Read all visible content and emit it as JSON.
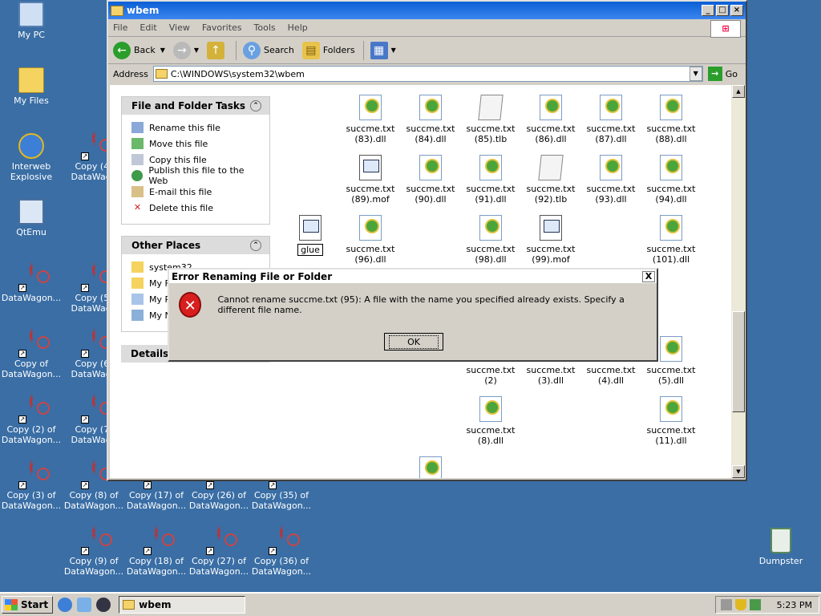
{
  "desktop": {
    "icons": [
      {
        "line1": "My PC",
        "line2": ""
      },
      {
        "line1": "My Files",
        "line2": ""
      },
      {
        "line1": "Interweb",
        "line2": "Explosive"
      },
      {
        "line1": "Copy (4)",
        "line2": "DataWago"
      },
      {
        "line1": "QtEmu",
        "line2": ""
      },
      {
        "line1": "DataWagon...",
        "line2": ""
      },
      {
        "line1": "Copy (5)",
        "line2": "DataWago"
      },
      {
        "line1": "Copy of",
        "line2": "DataWagon..."
      },
      {
        "line1": "Copy (6)",
        "line2": "DataWago"
      },
      {
        "line1": "Copy (2) of",
        "line2": "DataWagon..."
      },
      {
        "line1": "Copy (7)",
        "line2": "DataWago"
      },
      {
        "line1": "Copy (3) of",
        "line2": "DataWagon..."
      },
      {
        "line1": "Copy (8) of",
        "line2": "DataWagon..."
      },
      {
        "line1": "Copy (17) of",
        "line2": "DataWagon..."
      },
      {
        "line1": "Copy (26) of",
        "line2": "DataWagon..."
      },
      {
        "line1": "Copy (35) of",
        "line2": "DataWagon..."
      },
      {
        "line1": "Copy (9) of",
        "line2": "DataWagon..."
      },
      {
        "line1": "Copy (18) of",
        "line2": "DataWagon..."
      },
      {
        "line1": "Copy (27) of",
        "line2": "DataWagon..."
      },
      {
        "line1": "Copy (36) of",
        "line2": "DataWagon..."
      },
      {
        "line1": "Dumpster",
        "line2": ""
      }
    ]
  },
  "window": {
    "title": "wbem",
    "menu": [
      "File",
      "Edit",
      "View",
      "Favorites",
      "Tools",
      "Help"
    ],
    "toolbar": {
      "back": "Back",
      "search": "Search",
      "folders": "Folders"
    },
    "address_label": "Address",
    "address_value": "C:\\WINDOWS\\system32\\wbem",
    "go_label": "Go"
  },
  "tasks": {
    "title": "File and Folder Tasks",
    "items": [
      "Rename this file",
      "Move this file",
      "Copy this file",
      "Publish this file to the Web",
      "E-mail this file",
      "Delete this file"
    ]
  },
  "places": {
    "title": "Other Places",
    "items": [
      "system32",
      "My Fi",
      "My PC",
      "My Ne"
    ]
  },
  "details": {
    "title": "Details"
  },
  "files": [
    {
      "name": "succme.txt",
      "ext": "(83).dll",
      "kind": "dll"
    },
    {
      "name": "succme.txt",
      "ext": "(84).dll",
      "kind": "dll"
    },
    {
      "name": "succme.txt",
      "ext": "(85).tlb",
      "kind": "tlb"
    },
    {
      "name": "succme.txt",
      "ext": "(86).dll",
      "kind": "dll"
    },
    {
      "name": "succme.txt",
      "ext": "(87).dll",
      "kind": "dll"
    },
    {
      "name": "succme.txt",
      "ext": "(88).dll",
      "kind": "dll"
    },
    {
      "name": "succme.txt",
      "ext": "(89).mof",
      "kind": "mof"
    },
    {
      "name": "succme.txt",
      "ext": "(90).dll",
      "kind": "dll"
    },
    {
      "name": "succme.txt",
      "ext": "(91).dll",
      "kind": "dll"
    },
    {
      "name": "succme.txt",
      "ext": "(92).tlb",
      "kind": "tlb"
    },
    {
      "name": "succme.txt",
      "ext": "(93).dll",
      "kind": "dll"
    },
    {
      "name": "succme.txt",
      "ext": "(94).dll",
      "kind": "dll"
    },
    {
      "name": "glue",
      "ext": "",
      "kind": "mof"
    },
    {
      "name": "succme.txt",
      "ext": "(96).dll",
      "kind": "dll"
    },
    {
      "name": "succme.txt",
      "ext": "(98).dll",
      "kind": "dll"
    },
    {
      "name": "succme.txt",
      "ext": "(99).mof",
      "kind": "mof"
    },
    {
      "name": "succme.txt",
      "ext": "(101).dll",
      "kind": "dll"
    },
    {
      "name": "succme.txt (2)",
      "ext": "",
      "kind": "none"
    },
    {
      "name": "succme.txt",
      "ext": "(3).dll",
      "kind": "none"
    },
    {
      "name": "succme.txt",
      "ext": "(4).dll",
      "kind": "none"
    },
    {
      "name": "succme.txt",
      "ext": "(5).dll",
      "kind": "dll"
    },
    {
      "name": "succme.txt",
      "ext": "(8).dll",
      "kind": "dll"
    },
    {
      "name": "succme.txt",
      "ext": "(11).dll",
      "kind": "dll"
    },
    {
      "name": "",
      "ext": "",
      "kind": "dll"
    }
  ],
  "dialog": {
    "title": "Error Renaming File or Folder",
    "message": "Cannot rename succme.txt (95): A file with the name you specified already exists. Specify a different file name.",
    "ok": "OK",
    "close": "X"
  },
  "taskbar": {
    "start": "Start",
    "task": "wbem",
    "clock": "5:23 PM"
  }
}
